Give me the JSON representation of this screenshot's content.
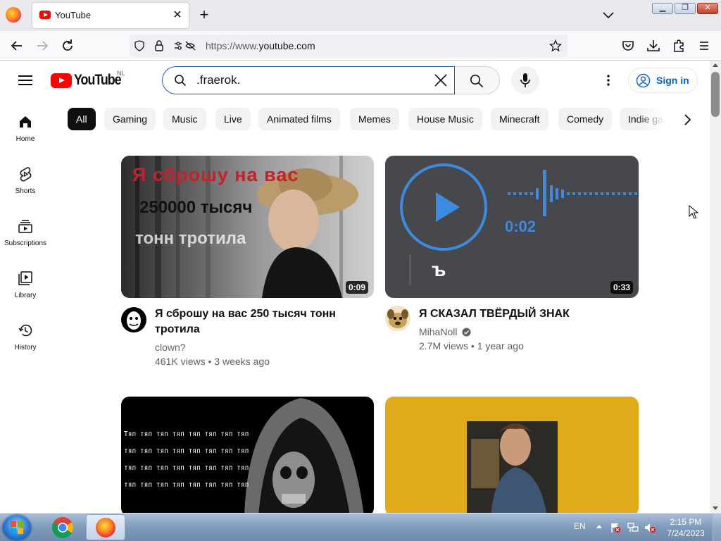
{
  "browser": {
    "tab_title": "YouTube",
    "tab_close_glyph": "✕",
    "new_tab_glyph": "+",
    "url_prefix": "https://www.",
    "url_domain": "youtube.com",
    "window_controls": {
      "minimize": "▁",
      "maximize": "❐",
      "close": "✕"
    }
  },
  "youtube": {
    "logo_text": "YouTube",
    "region": "NL",
    "search_value": ".fraerok.",
    "sign_in_label": "Sign in",
    "sidebar": [
      {
        "label": "Home",
        "icon": "home-icon"
      },
      {
        "label": "Shorts",
        "icon": "shorts-icon"
      },
      {
        "label": "Subscriptions",
        "icon": "subscriptions-icon"
      },
      {
        "label": "Library",
        "icon": "library-icon"
      },
      {
        "label": "History",
        "icon": "history-icon"
      }
    ],
    "chips": [
      "All",
      "Gaming",
      "Music",
      "Live",
      "Animated films",
      "Memes",
      "House Music",
      "Minecraft",
      "Comedy",
      "Indie games"
    ],
    "active_chip": "All",
    "videos": [
      {
        "title_line1": "Я сброшу на вас 250 тысяч тонн",
        "title_line2": "тротила",
        "channel": "clown?",
        "views": "461K views",
        "age": "3 weeks ago",
        "duration": "0:09",
        "thumb_text": [
          "Я сброшу на вас",
          "250000 тысяч",
          "тонн тротила"
        ]
      },
      {
        "title_line1": "Я СКАЗАЛ ТВЁРДЫЙ ЗНАК",
        "channel": "MihaNoll",
        "verified": true,
        "views": "2.7M views",
        "age": "1 year ago",
        "duration": "0:33",
        "thumb_text": [
          "0:02",
          "ъ"
        ]
      },
      {
        "thumb_text": [
          "Тяп тяп тяп тяп тяп тяп тяп тяп",
          "тяп тяп тяп тяп тяп тяп тяп тяп",
          "тяп тяп тяп тяп тяп тяп тяп тяп",
          "тяп тяп тяп тяп тяп тяп тяп тяп"
        ]
      },
      {}
    ],
    "separator": "•"
  },
  "taskbar": {
    "language": "EN",
    "time": "2:15 PM",
    "date": "7/24/2023"
  },
  "colors": {
    "youtube_red": "#ff0000",
    "search_border": "#1c62b9",
    "sign_in_blue": "#065fd4",
    "chip_active": "#0f0f0f"
  }
}
